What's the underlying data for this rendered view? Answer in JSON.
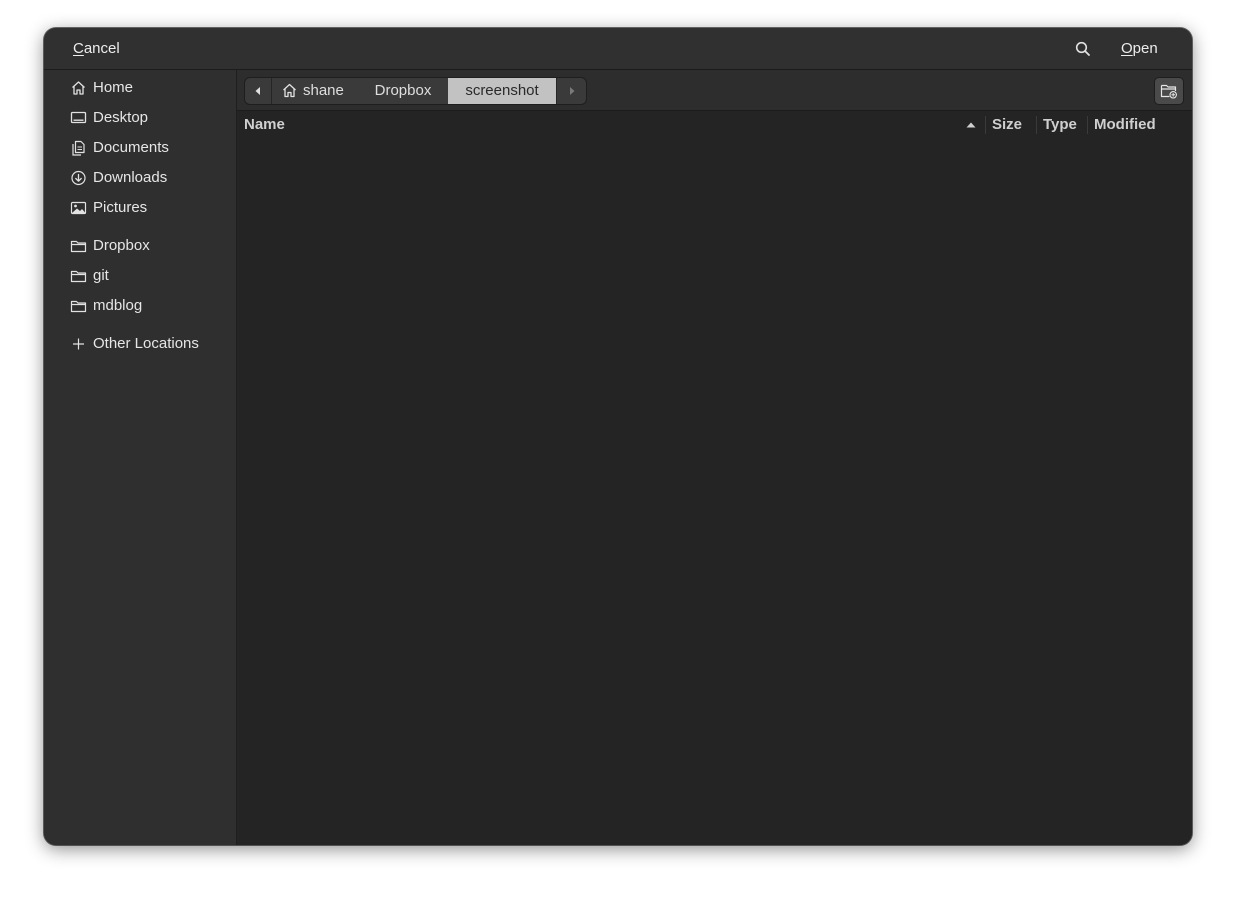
{
  "header": {
    "cancel_label_mnemonic": "C",
    "cancel_label_rest": "ancel",
    "open_label_mnemonic": "O",
    "open_label_rest": "pen",
    "search_icon": "search-icon"
  },
  "sidebar": {
    "places": [
      {
        "label": "Home",
        "icon": "home-icon"
      },
      {
        "label": "Desktop",
        "icon": "desktop-icon"
      },
      {
        "label": "Documents",
        "icon": "documents-icon"
      },
      {
        "label": "Downloads",
        "icon": "downloads-icon"
      },
      {
        "label": "Pictures",
        "icon": "pictures-icon"
      }
    ],
    "bookmarks": [
      {
        "label": "Dropbox",
        "icon": "folder-icon"
      },
      {
        "label": "git",
        "icon": "folder-icon"
      },
      {
        "label": "mdblog",
        "icon": "folder-icon"
      }
    ],
    "other": {
      "label": "Other Locations",
      "icon": "plus-icon"
    }
  },
  "pathbar": {
    "crumbs": [
      "shane",
      "Dropbox",
      "screenshot"
    ],
    "active": "screenshot",
    "new_folder_icon": "new-folder-icon"
  },
  "columns": {
    "name": "Name",
    "size": "Size",
    "type": "Type",
    "modified": "Modified",
    "sort": "ascending"
  },
  "colors": {
    "window_bg": "#2d2d2d",
    "content_bg": "#242424",
    "active_crumb_bg": "#c2c2c2"
  }
}
